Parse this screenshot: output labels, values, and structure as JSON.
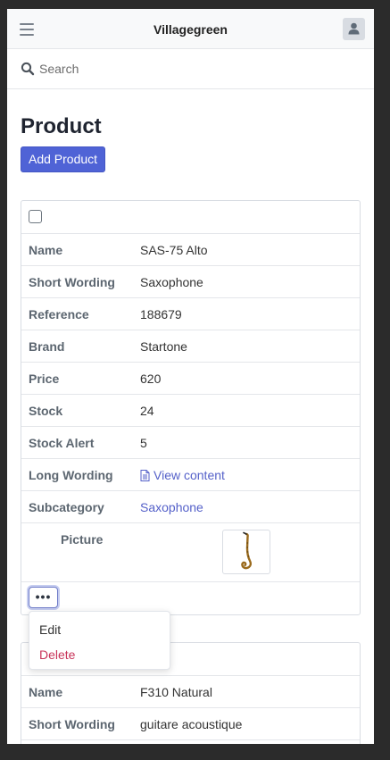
{
  "header": {
    "title": "Villagegreen",
    "menu_icon": "hamburger-icon",
    "user_icon": "user-icon"
  },
  "search": {
    "placeholder": "Search",
    "value": ""
  },
  "page": {
    "title": "Product",
    "add_label": "Add Product"
  },
  "colors": {
    "primary": "#4f63d6",
    "link": "#5561c9",
    "danger": "#c8345a"
  },
  "products": [
    {
      "rows": [
        {
          "label": "Name",
          "value": "SAS-75 Alto"
        },
        {
          "label": "Short Wording",
          "value": "Saxophone"
        },
        {
          "label": "Reference",
          "value": "188679"
        },
        {
          "label": "Brand",
          "value": "Startone"
        },
        {
          "label": "Price",
          "value": "620"
        },
        {
          "label": "Stock",
          "value": "24"
        },
        {
          "label": "Stock Alert",
          "value": "5"
        },
        {
          "label": "Long Wording",
          "value": "View content"
        },
        {
          "label": "Subcategory",
          "value": "Saxophone"
        }
      ],
      "picture_label": "Picture",
      "actions": {
        "more": "•••",
        "edit": "Edit",
        "delete": "Delete"
      }
    },
    {
      "rows": [
        {
          "label": "Name",
          "value": "F310 Natural"
        },
        {
          "label": "Short Wording",
          "value": "guitare acoustique"
        }
      ]
    }
  ]
}
